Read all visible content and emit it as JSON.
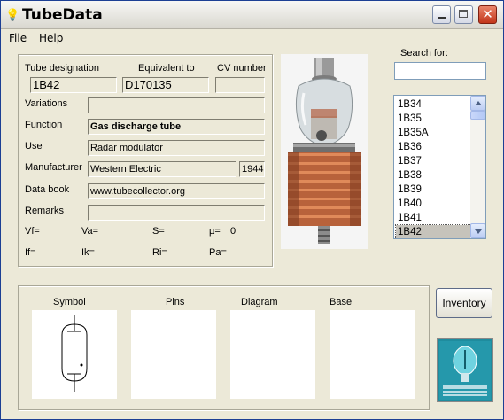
{
  "window": {
    "title": "TubeData"
  },
  "menu": {
    "file": "File",
    "help": "Help"
  },
  "form": {
    "tube_designation_label": "Tube designation",
    "tube_designation": "1B42",
    "equivalent_label": "Equivalent to",
    "equivalent": "D170135",
    "cv_label": "CV number",
    "cv": "",
    "variations_label": "Variations",
    "variations": "",
    "function_label": "Function",
    "function": "Gas discharge tube",
    "use_label": "Use",
    "use": "Radar modulator",
    "manufacturer_label": "Manufacturer",
    "manufacturer": "Western Electric",
    "year": "1944",
    "databook_label": "Data book",
    "databook": "www.tubecollector.org",
    "remarks_label": "Remarks",
    "remarks": "",
    "params": {
      "vf": "Vf=",
      "va": "Va=",
      "s": "S=",
      "mu": "µ=",
      "mu_value": "0",
      "if": "If=",
      "ik": "Ik=",
      "ri": "Ri=",
      "pa": "Pa="
    }
  },
  "search": {
    "label": "Search for:",
    "value": ""
  },
  "tube_list": {
    "items": [
      "1B34",
      "1B35",
      "1B35A",
      "1B36",
      "1B37",
      "1B38",
      "1B39",
      "1B40",
      "1B41",
      "1B42"
    ],
    "selected": "1B42"
  },
  "sections": {
    "symbol": "Symbol",
    "pins": "Pins",
    "diagram": "Diagram",
    "base": "Base"
  },
  "buttons": {
    "inventory": "Inventory"
  },
  "icons": {
    "app": "lightbulb-icon",
    "minimize": "minimize-icon",
    "maximize": "maximize-icon",
    "close": "close-icon",
    "scroll_up": "scroll-up-arrow-icon",
    "scroll_down": "scroll-down-arrow-icon"
  }
}
